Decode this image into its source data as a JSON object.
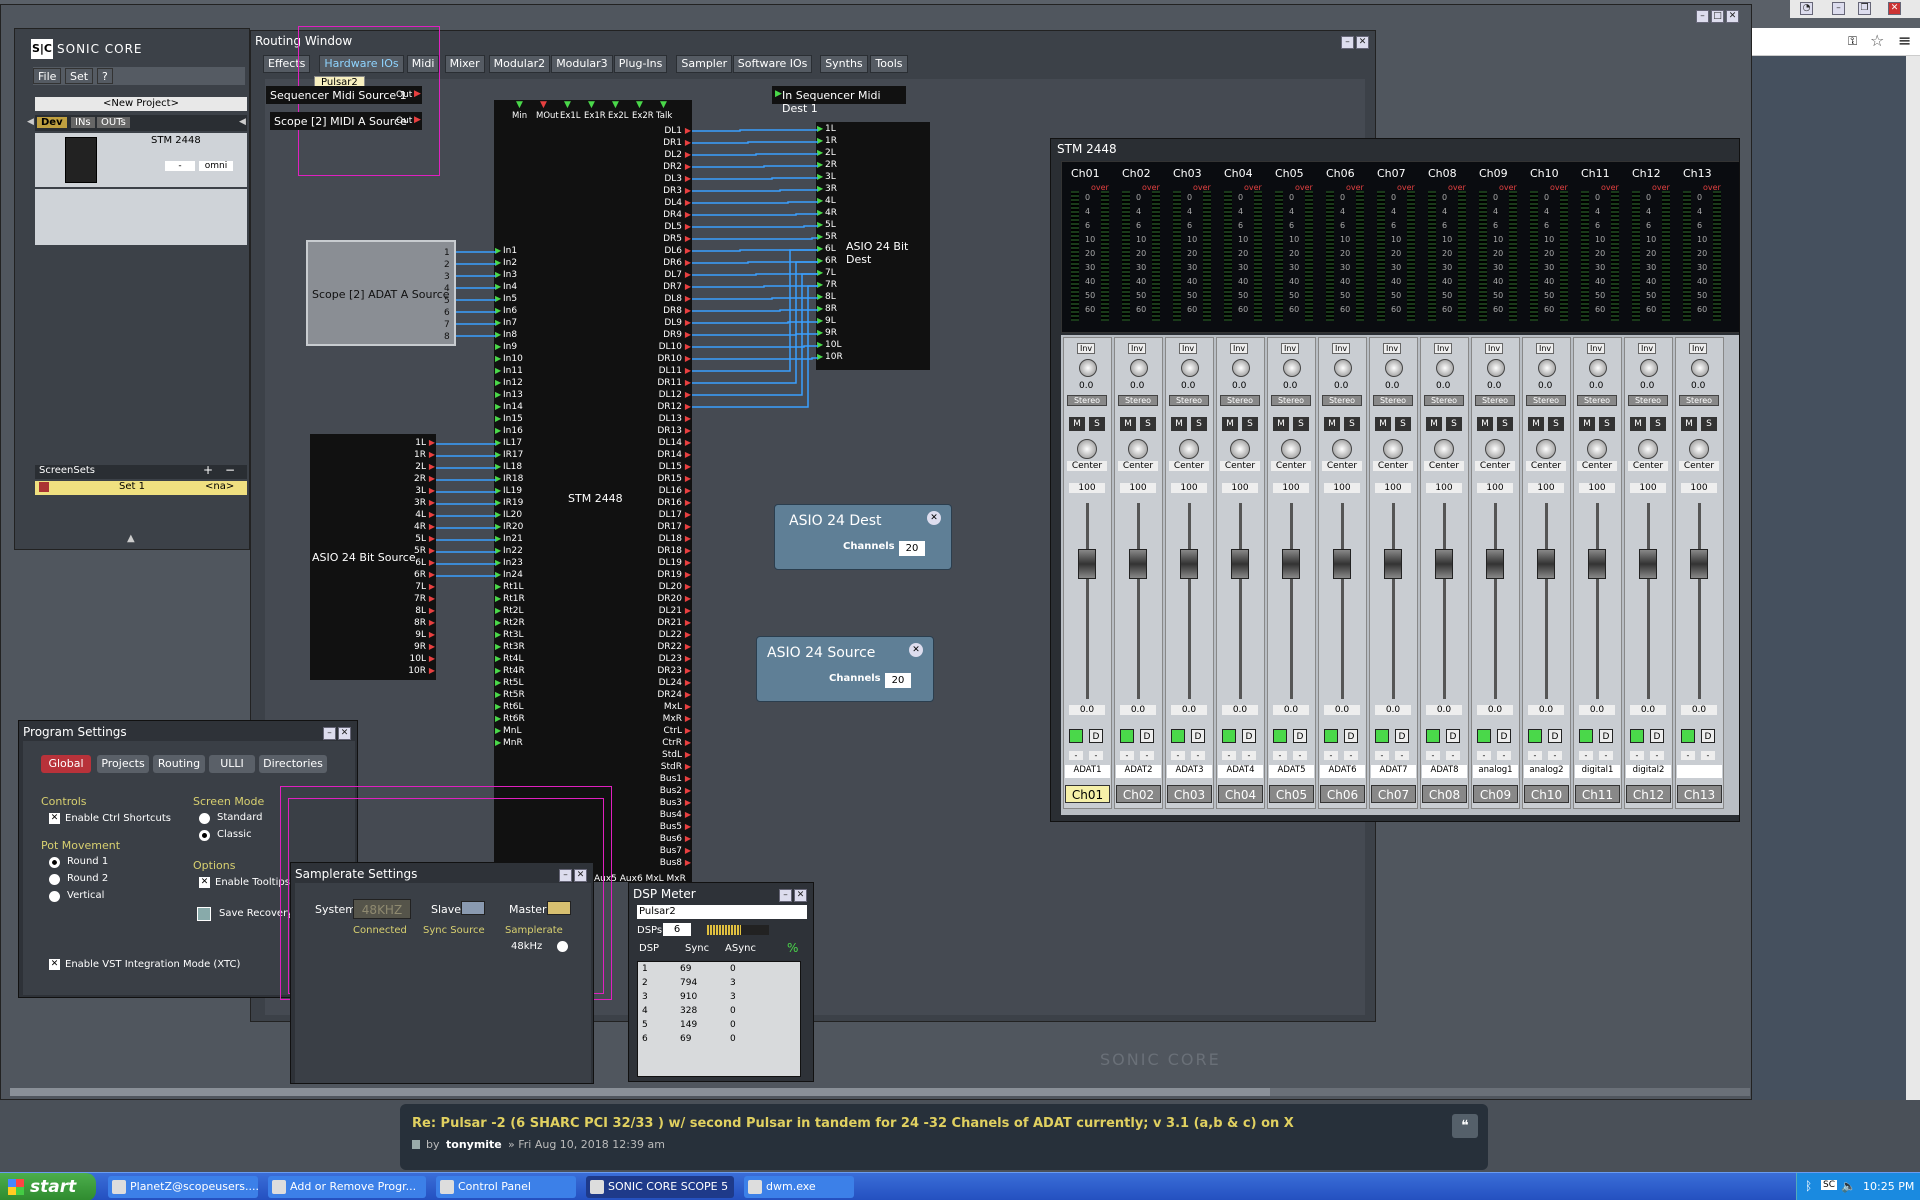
{
  "routing": {
    "title": "Routing Window",
    "tabs": [
      "Effects",
      "Hardware IOs",
      "Midi",
      "Mixer",
      "Modular2",
      "Modular3",
      "Plug-Ins",
      "Sampler",
      "Software IOs",
      "Synths",
      "Tools"
    ],
    "tooltip": "Pulsar2",
    "midi_src1": "Sequencer Midi Source 1",
    "midi_src2": "Scope [2] MIDI A Source",
    "out_label": "Out",
    "midi_dest": "In Sequencer Midi Dest 1",
    "adat_src": "Scope [2] ADAT A Source",
    "asio_src_block": "ASIO 24 Bit Source",
    "asio_dest_block": "ASIO 24 Bit Dest",
    "stm_label": "STM 2448",
    "stm_top": [
      "Min",
      "MOut",
      "Ex1L",
      "Ex1R",
      "Ex2L",
      "Ex2R",
      "Talk"
    ],
    "stm_bottom": "Aux5 Aux6 MxL MxR",
    "asio_dest": {
      "title": "ASIO 24 Dest",
      "channels_label": "Channels",
      "channels": "20"
    },
    "asio_source": {
      "title": "ASIO 24 Source",
      "channels_label": "Channels",
      "channels": "20"
    },
    "adat_ports": [
      "1",
      "2",
      "3",
      "4",
      "5",
      "6",
      "7",
      "8"
    ],
    "asio_src_ports": [
      "1L",
      "1R",
      "2L",
      "2R",
      "3L",
      "3R",
      "4L",
      "4R",
      "5L",
      "5R",
      "6L",
      "6R",
      "7L",
      "7R",
      "8L",
      "8R",
      "9L",
      "9R",
      "10L",
      "10R"
    ],
    "stm_inputs": [
      "In1",
      "In2",
      "In3",
      "In4",
      "In5",
      "In6",
      "In7",
      "In8",
      "In9",
      "In10",
      "In11",
      "In12",
      "In13",
      "In14",
      "In15",
      "In16",
      "IL17",
      "IR17",
      "IL18",
      "IR18",
      "IL19",
      "IR19",
      "IL20",
      "IR20",
      "In21",
      "In22",
      "In23",
      "In24",
      "Rt1L",
      "Rt1R",
      "Rt2L",
      "Rt2R",
      "Rt3L",
      "Rt3R",
      "Rt4L",
      "Rt4R",
      "Rt5L",
      "Rt5R",
      "Rt6L",
      "Rt6R",
      "MnL",
      "MnR"
    ],
    "stm_outputs": [
      "DL1",
      "DR1",
      "DL2",
      "DR2",
      "DL3",
      "DR3",
      "DL4",
      "DR4",
      "DL5",
      "DR5",
      "DL6",
      "DR6",
      "DL7",
      "DR7",
      "DL8",
      "DR8",
      "DL9",
      "DR9",
      "DL10",
      "DR10",
      "DL11",
      "DR11",
      "DL12",
      "DR12",
      "DL13",
      "DR13",
      "DL14",
      "DR14",
      "DL15",
      "DR15",
      "DL16",
      "DR16",
      "DL17",
      "DR17",
      "DL18",
      "DR18",
      "DL19",
      "DR19",
      "DL20",
      "DR20",
      "DL21",
      "DR21",
      "DL22",
      "DR22",
      "DL23",
      "DR23",
      "DL24",
      "DR24",
      "MxL",
      "MxR",
      "CtrL",
      "CtrR",
      "StdL",
      "StdR",
      "Bus1",
      "Bus2",
      "Bus3",
      "Bus4",
      "Bus5",
      "Bus6",
      "Bus7",
      "Bus8"
    ],
    "asio_dest_ports": [
      "1L",
      "1R",
      "2L",
      "2R",
      "3L",
      "3R",
      "4L",
      "4R",
      "5L",
      "5R",
      "6L",
      "6R",
      "7L",
      "7R",
      "8L",
      "8R",
      "9L",
      "9R",
      "10L",
      "10R"
    ]
  },
  "sc": {
    "logo": "SONIC CORE",
    "menu": [
      "File",
      "Set",
      "?"
    ],
    "project": "<New Project>",
    "subtabs": [
      "Dev",
      "INs",
      "OUTs"
    ],
    "device_name": "STM 2448",
    "omni": "omni",
    "dash": "-",
    "screensets_title": "ScreenSets",
    "set_name": "Set 1",
    "set_na": "<na>"
  },
  "program_settings": {
    "title": "Program Settings",
    "tabs": [
      "Global",
      "Projects",
      "Routing",
      "ULLI",
      "Directories"
    ],
    "controls_title": "Controls",
    "enable_ctrl": "Enable Ctrl Shortcuts",
    "pot_title": "Pot Movement",
    "pot_opts": [
      "Round 1",
      "Round 2",
      "Vertical"
    ],
    "screen_mode_title": "Screen Mode",
    "screen_opts": [
      "Standard",
      "Classic"
    ],
    "options_title": "Options",
    "enable_tooltips": "Enable Tooltips",
    "save_recovery": "Save Recovery",
    "enable_vst": "Enable VST Integration Mode (XTC)"
  },
  "samplerate": {
    "title": "Samplerate Settings",
    "system": "System",
    "system_value": "48KHZ",
    "connected": "Connected",
    "slave": "Slave",
    "sync_source": "Sync Source",
    "master": "Master",
    "samplerate_label": "Samplerate",
    "rate": "48kHz"
  },
  "dsp": {
    "title": "DSP Meter",
    "device": "Pulsar2",
    "dsps_label": "DSPs",
    "dsps_value": "6",
    "headers": [
      "DSP",
      "Sync",
      "ASync"
    ],
    "rows": [
      [
        "1",
        "69",
        "0"
      ],
      [
        "2",
        "794",
        "3"
      ],
      [
        "3",
        "910",
        "3"
      ],
      [
        "4",
        "328",
        "0"
      ],
      [
        "5",
        "149",
        "0"
      ],
      [
        "6",
        "69",
        "0"
      ]
    ]
  },
  "stm": {
    "title": "STM 2448",
    "channels": [
      "Ch01",
      "Ch02",
      "Ch03",
      "Ch04",
      "Ch05",
      "Ch06",
      "Ch07",
      "Ch08",
      "Ch09",
      "Ch10",
      "Ch11",
      "Ch12",
      "Ch13"
    ],
    "over": "over",
    "scale": [
      "0",
      "4",
      "6",
      "10",
      "20",
      "30",
      "40",
      "50",
      "60"
    ],
    "inv": "Inv",
    "gain": "0.0",
    "stereo": "Stereo",
    "m": "M",
    "s": "S",
    "center": "Center",
    "hundred": "100",
    "fader": "0.0",
    "d": "D",
    "dash": "-",
    "names": [
      "ADAT1",
      "ADAT2",
      "ADAT3",
      "ADAT4",
      "ADAT5",
      "ADAT6",
      "ADAT7",
      "ADAT8",
      "analog1",
      "analog2",
      "digital1",
      "digital2",
      ""
    ]
  },
  "watermark": "SONIC CORE",
  "forum": {
    "title": "Re: Pulsar -2 (6 SHARC PCI 32/33 ) w/ second Pulsar in tandem for 24 -32 Chanels of ADAT currently; v 3.1 (a,b & c) on X",
    "by": "by",
    "author": "tonymite",
    "date": "» Fri Aug 10, 2018 12:39 am"
  },
  "taskbar": {
    "start": "start",
    "items": [
      "PlanetZ@scopeusers....",
      "Add or Remove Progr...",
      "Control Panel",
      "SONIC CORE SCOPE 5",
      "dwm.exe"
    ],
    "time": "10:25 PM",
    "tray": "SC"
  },
  "colors": {
    "cable": "#3aa0ff",
    "led_green": "#4ad84a",
    "magenta": "#e020c0",
    "red_tab": "#b8323a",
    "asio_blue": "#5f7f96"
  }
}
